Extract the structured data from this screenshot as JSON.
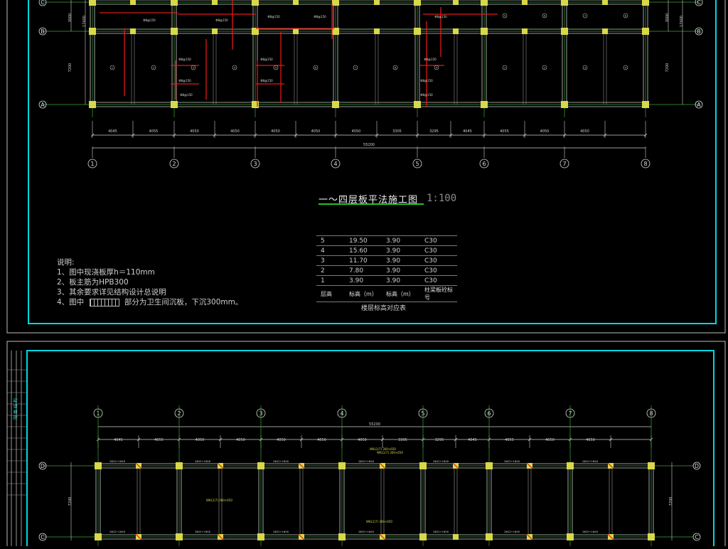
{
  "drawing": {
    "title": "一～四层板平法施工图",
    "scale": "1:100",
    "notes_heading": "说明:",
    "notes": [
      "1、图中现浇板厚h＝110mm",
      "2、板主筋为HPB300",
      "3、其余要求详见结构设计总说明",
      "4、图中",
      "部分为卫生间沉板，下沉300mm。"
    ]
  },
  "level_table": {
    "caption": "楼层标高对应表",
    "headers": [
      "层高",
      "标高（m）",
      "标高（m）",
      "柱梁板砼标号"
    ],
    "rows": [
      [
        "5",
        "19.50",
        "3.90",
        "C30"
      ],
      [
        "4",
        "15.60",
        "3.90",
        "C30"
      ],
      [
        "3",
        "11.70",
        "3.90",
        "C30"
      ],
      [
        "2",
        "7.80",
        "3.90",
        "C30"
      ],
      [
        "1",
        "3.90",
        "3.90",
        "C30"
      ]
    ]
  },
  "grid": {
    "columns": [
      "1",
      "2",
      "3",
      "4",
      "5",
      "6",
      "7",
      "8"
    ],
    "rows_top": [
      "C",
      "B",
      "A"
    ],
    "rows_bottom": [
      "D",
      "C"
    ],
    "bay_dims": [
      "4045",
      "4055",
      "4050",
      "4050",
      "4050",
      "4050",
      "4050",
      "3305",
      "3295",
      "4045",
      "4055",
      "4050",
      "4050"
    ],
    "total_dim": "55200",
    "side_dims_top": [
      "3000",
      "7200"
    ],
    "side_total_top": "17400",
    "side_dim_bottom": "7200"
  },
  "colors": {
    "frame": "#00d6e0",
    "grid_line": "#3aa63a",
    "beam": "#c8c8c8",
    "column": "#d8d84a",
    "rebar": "#e01818",
    "dim": "#d0d0d0",
    "underline": "#24c424"
  }
}
